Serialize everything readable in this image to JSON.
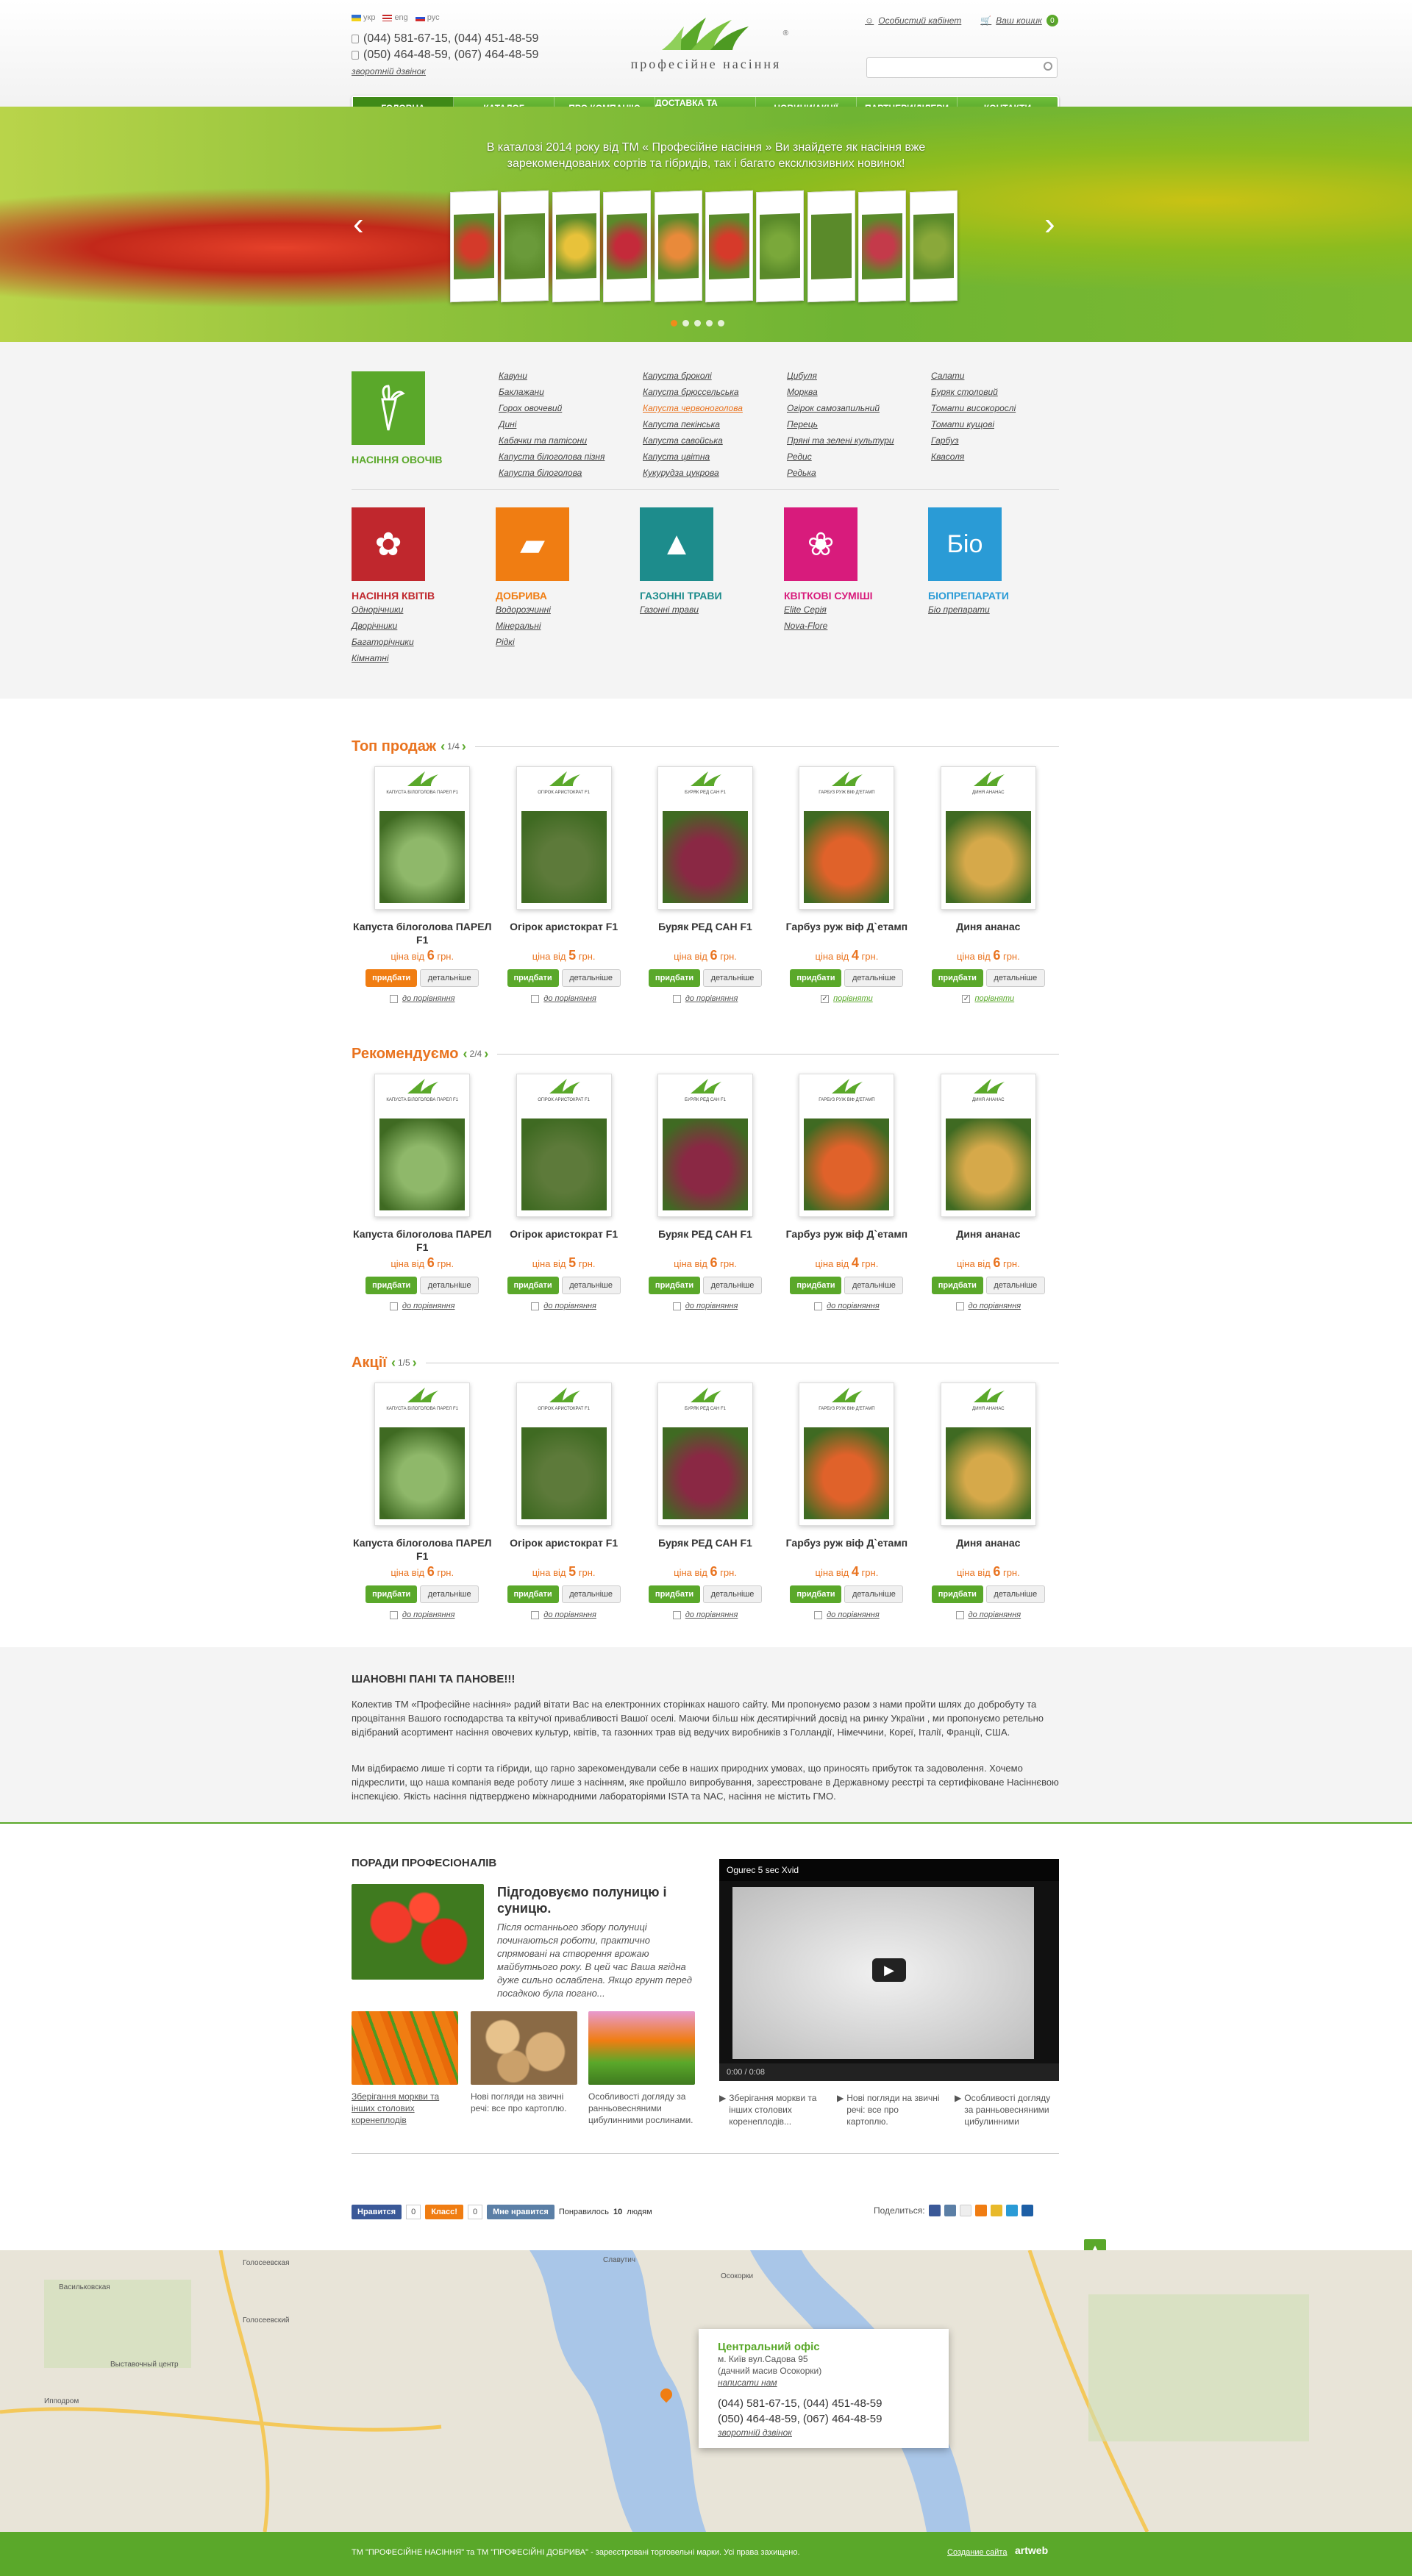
{
  "header": {
    "langs": [
      "укр",
      "eng",
      "рус"
    ],
    "phones": [
      "(044) 581-67-15, (044) 451-48-59",
      "(050) 464-48-59, (067) 464-48-59"
    ],
    "callback": "зворотній дзвінок",
    "logo_text": "професійне насіння",
    "cabinet": "Особистий кабінет",
    "cart": "Ваш кошик",
    "cart_count": "0"
  },
  "nav": [
    "ГОЛОВНА",
    "КАТАЛОГ",
    "ПРО КОМПАНІЮ",
    "ДОСТАВКА ТА ОПЛАТА",
    "НОВИНИ/АКЦІЇ",
    "ПАРТНЕРИ/ДІЛЕРИ",
    "КОНТАКТИ"
  ],
  "slider": {
    "caption": "В каталозі 2014 року від ТМ « Професійне насіння » Ви знайдете як насіння вже зарекомендованих сортів та гібридів, так і багато ексклюзивних новинок!"
  },
  "catalog": {
    "veg_title": "НАСІННЯ ОВОЧІВ",
    "veg_cols": [
      [
        "Кавуни",
        "Баклажани",
        "Горох овочевий",
        "Дині",
        "Кабачки та патісони",
        "Капуста білоголова пізня",
        "Капуста білоголова"
      ],
      [
        "Капуста броколі",
        "Капуста брюссельська",
        "Капуста червоноголова",
        "Капуста пекінська",
        "Капуста савойська",
        "Капуста цвітна",
        "Кукурудза цукрова"
      ],
      [
        "Цибуля",
        "Морква",
        "Огірок самозапильний",
        "Перець",
        "Пряні та зелені культури",
        "Редис",
        "Редька"
      ],
      [
        "Салати",
        "Буряк столовий",
        "Томати високорослі",
        "Томати кущові",
        "Гарбуз",
        "Квасоля"
      ]
    ],
    "cats": [
      {
        "title": "НАСІННЯ КВІТІВ",
        "color": "#c0272d",
        "links": [
          "Однорічники",
          "Дворічники",
          "Багаторічники",
          "Кімнатні"
        ]
      },
      {
        "title": "ДОБРИВА",
        "color": "#f07d12",
        "links": [
          "Водорозчинні",
          "Мінеральні",
          "Рідкі"
        ]
      },
      {
        "title": "ГАЗОННІ ТРАВИ",
        "color": "#1d8c8c",
        "links": [
          "Газонні трави"
        ]
      },
      {
        "title": "КВІТКОВІ СУМІШІ",
        "color": "#d81b7c",
        "links": [
          "Elite Серія",
          "Nova-Flore"
        ]
      },
      {
        "title": "БІОПРЕПАРАТИ",
        "color": "#2a9bd6",
        "links": [
          "Біо препарати"
        ],
        "tile_text": "Біо"
      }
    ]
  },
  "sections": [
    {
      "title": "Топ продаж",
      "page": "1/4"
    },
    {
      "title": "Рекомендуємо",
      "page": "2/4"
    },
    {
      "title": "Акції",
      "page": "1/5"
    }
  ],
  "products": [
    {
      "name": "Капуста білоголова ПАРЕЛ F1",
      "pack": "КАПУСТА БІЛОГОЛОВА ПАРЕЛ F1",
      "price": "6",
      "color": "#8fb86a"
    },
    {
      "name": "Огірок аристократ F1",
      "pack": "ОГІРОК АРИСТОКРАТ F1",
      "price": "5",
      "color": "#5d7a3a"
    },
    {
      "name": "Буряк РЕД САН F1",
      "pack": "БУРЯК РЕД САН F1",
      "price": "6",
      "color": "#8a2844"
    },
    {
      "name": "Гарбуз руж віф Д`етамп",
      "pack": "ГАРБУЗ РУЖ ВІФ Д'ЕТАМП",
      "price": "4",
      "color": "#e0622a"
    },
    {
      "name": "Диня ананас",
      "pack": "ДИНЯ АНАНАС",
      "price": "6",
      "color": "#d6a94a"
    }
  ],
  "labels": {
    "price_prefix": "ціна від",
    "currency": "грн.",
    "buy": "придбати",
    "details": "детальніше",
    "compare": "до порівняння",
    "compared": "порівняти"
  },
  "about": {
    "title": "ШАНОВНІ ПАНІ ТА ПАНОВЕ!!!",
    "p1": "Колектив ТМ «Професійне насіння» радий вітати Вас на електронних сторінках нашого сайту. Ми пропонуємо разом з нами пройти шлях до добробуту та процвітання Вашого господарства та квітучої привабливості Вашої оселі. Маючи більш ніж десятирічний досвід на ринку України , ми пропонуємо ретельно відібраний асортимент насіння овочевих культур, квітів, та газонних трав від ведучих виробників з Голландії, Німеччини, Кореї, Італії, Франції, США.",
    "p2": "Ми відбираємо лише ті сорти та гібриди, що гарно зарекомендували себе в наших природних умовах, що приносять прибуток та задоволення. Хочемо підкреслити, що наша компанія веде роботу лише з насінням, яке пройшло випробування, зареєстроване в Державному реєстрі та сертифіковане Насіннєвою інспекцією. Якість насіння підтверджено міжнародними лабораторіями ISTA та NAC, насіння не містить ГМО."
  },
  "tips": {
    "title": "ПОРАДИ ПРОФЕСІОНАЛІВ",
    "main_title": "Підгодовуємо полуницю і суницю.",
    "main_text": "Після останнього збору полуниці починаються роботи, практично спрямовані на створення врожаю майбутнього року. В цей час Ваша ягідна дуже сильно ослаблена. Якщо грунт перед посадкою була погано...",
    "small": [
      "Зберігання моркви та інших столових коренеплодів",
      "Нові погляди на звичні речі: все про картоплю.",
      "Особливості догляду за ранньовесняними цибулинними рослинами."
    ],
    "video_title": "Ogurec 5 sec Xvid",
    "video_time": "0:00 / 0:08",
    "video_links": [
      "Зберігання моркви та інших столових коренеплодів...",
      "Нові погляди на звичні речі: все про картоплю.",
      "Особливості догляду за ранньовесняними цибулинними"
    ]
  },
  "social": {
    "vk": "Мне нравится",
    "fb": "Нравится",
    "fb_count": "0",
    "ok": "Класс!",
    "ok_count": "0",
    "liked_prefix": "Понравилось",
    "liked_count": "10",
    "liked_suffix": "людям",
    "share": "Поделиться:"
  },
  "map": {
    "office_title": "Центральний офіс",
    "address1": "м. Київ вул.Садова 95",
    "address2": "(дачний масив Осокорки)",
    "write": "написати нам",
    "phones": [
      "(044) 581-67-15, (044) 451-48-59",
      "(050) 464-48-59, (067) 464-48-59"
    ],
    "callback": "зворотній дзвінок",
    "labels": [
      "Голосеевская",
      "Васильковская",
      "Голосеевский",
      "Выставочный центр",
      "Ипподром",
      "Осокорки",
      "Славутич"
    ]
  },
  "footer": {
    "text": "ТМ \"ПРОФЕСІЙНЕ НАСІННЯ\" та ТМ \"ПРОФЕСІЙНІ ДОБРИВА\" - зареєстровані торговельні марки. Усі права захищено.",
    "created": "Создание сайта",
    "studio": "artweb"
  }
}
